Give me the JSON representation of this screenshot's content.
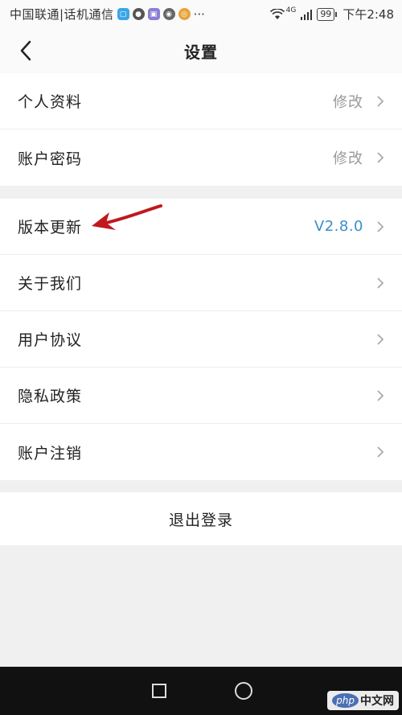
{
  "status_bar": {
    "carrier": "中国联通|话机通信",
    "dots": "···",
    "network": "4G",
    "battery": "99",
    "time": "下午2:48"
  },
  "header": {
    "title": "设置"
  },
  "account_group": [
    {
      "label": "个人资料",
      "value": "修改"
    },
    {
      "label": "账户密码",
      "value": "修改"
    }
  ],
  "info_group": [
    {
      "label": "版本更新",
      "value": "V2.8.0"
    },
    {
      "label": "关于我们",
      "value": ""
    },
    {
      "label": "用户协议",
      "value": ""
    },
    {
      "label": "隐私政策",
      "value": ""
    },
    {
      "label": "账户注销",
      "value": ""
    }
  ],
  "logout": {
    "label": "退出登录"
  },
  "watermark": {
    "brand": "php",
    "site": "中文网"
  },
  "colors": {
    "accent_version": "#3a8fc8",
    "annotation_arrow": "#c0181d"
  }
}
